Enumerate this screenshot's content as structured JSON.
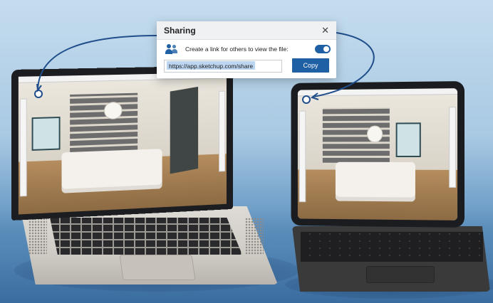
{
  "dialog": {
    "title": "Sharing",
    "close_icon": "close-icon",
    "share_text": "Create a link for others to view the file:",
    "toggle_on": true,
    "url": "https://app.sketchup.com/share",
    "copy_label": "Copy"
  },
  "colors": {
    "accent": "#1f5fa3",
    "background_top": "#c4dcee",
    "background_bottom": "#3f74a6"
  },
  "icons": {
    "people": "people-icon",
    "toggle": "toggle-switch-icon",
    "share_marker": "share-marker-icon"
  }
}
